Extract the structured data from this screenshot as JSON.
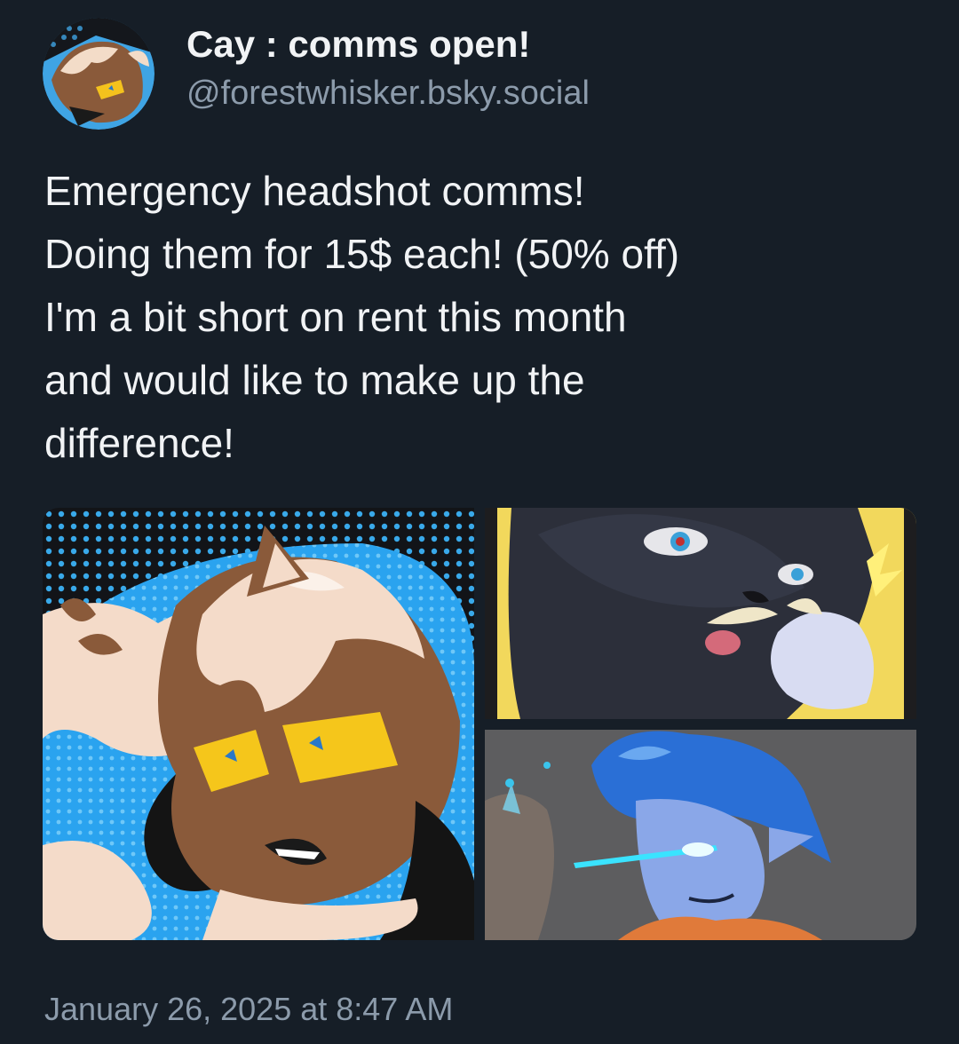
{
  "author": {
    "display_name": "Cay : comms open!",
    "handle": "@forestwhisker.bsky.social"
  },
  "post": {
    "lines": [
      "Emergency headshot comms!",
      "Doing them for 15$ each! (50% off)",
      "I'm a bit short on rent this month",
      "and would like to make up the",
      "difference!"
    ],
    "timestamp": "January 26, 2025 at 8:47 AM"
  },
  "colors": {
    "background": "#161e27",
    "text_primary": "#f1f3f5",
    "text_secondary": "#8c9bab"
  }
}
